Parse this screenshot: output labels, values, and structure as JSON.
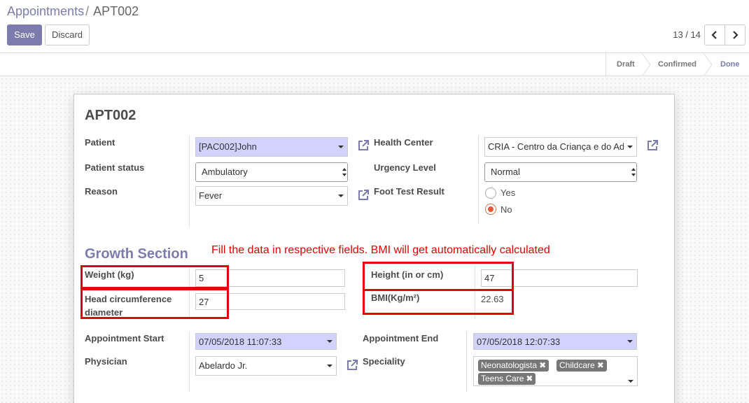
{
  "breadcrumb": {
    "parent": "Appointments",
    "separator": "/",
    "current": "APT002"
  },
  "toolbar": {
    "save_label": "Save",
    "discard_label": "Discard"
  },
  "pager": {
    "value": "13 / 14",
    "prev_icon": "chevron-left-icon",
    "next_icon": "chevron-right-icon"
  },
  "statusbar": {
    "stages": [
      "Draft",
      "Confirmed",
      "Done"
    ],
    "current": "Done"
  },
  "form": {
    "title": "APT002",
    "patient": {
      "label": "Patient",
      "value": "[PAC002]John"
    },
    "patient_status": {
      "label": "Patient status",
      "value": "Ambulatory"
    },
    "reason": {
      "label": "Reason",
      "value": "Fever"
    },
    "health_center": {
      "label": "Health Center",
      "value": "CRIA - Centro da Criança e do Adolescente"
    },
    "urgency_level": {
      "label": "Urgency Level",
      "value": "Normal"
    },
    "foot_test": {
      "label": "Foot Test Result",
      "options": [
        "Yes",
        "No"
      ],
      "selected": "No"
    },
    "growth": {
      "title": "Growth Section",
      "note": "Fill the data in respective fields. BMI will get automatically calculated",
      "weight": {
        "label": "Weight (kg)",
        "value": "5"
      },
      "head": {
        "label_line1": "Head circumference",
        "label_line2": "diameter",
        "value": "27"
      },
      "height": {
        "label": "Height (in or cm)",
        "value": "47"
      },
      "bmi": {
        "label": "BMI(Kg/m²)",
        "value": "22.63"
      }
    },
    "appointment_start": {
      "label": "Appointment Start",
      "value": "07/05/2018 11:07:33"
    },
    "appointment_end": {
      "label": "Appointment End",
      "value": "07/05/2018 12:07:33"
    },
    "physician": {
      "label": "Physician",
      "value": "Abelardo Jr."
    },
    "speciality": {
      "label": "Speciality",
      "tags": [
        "Neonatologista",
        "Childcare",
        "Teens Care"
      ]
    }
  },
  "colors": {
    "brand": "#7c7bad",
    "required_field": "#d2d2ff",
    "highlight": "#e80000",
    "radio_checked": "#e2563a"
  }
}
